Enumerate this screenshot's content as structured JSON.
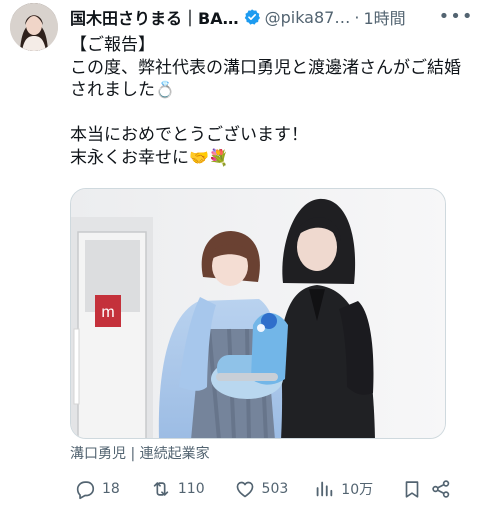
{
  "user": {
    "display_name": "国木田さりまる｜BA…",
    "handle": "@pika87…",
    "time": "1時間"
  },
  "tweet": {
    "lines": [
      "【ご報告】",
      "この度、弊社代表の溝口勇児と渡邊渚さんがご結婚",
      "されました",
      "",
      "本当におめでとうございます！",
      "末永くお幸せに"
    ],
    "emoji_ring": "💍",
    "emoji_end": "🤝💐",
    "image_caption": "溝口勇児 | 連続起業家"
  },
  "stats": {
    "replies": "18",
    "retweets": "110",
    "likes": "503",
    "views": "10万"
  },
  "colors": {
    "text": "#0f1419",
    "muted": "#536471",
    "verified": "#1d9bf0",
    "background": "#ffffff"
  },
  "icons": {
    "verified": "verified-badge-icon",
    "more": "more-dots-icon",
    "reply": "reply-icon",
    "retweet": "retweet-icon",
    "like": "heart-icon",
    "views": "views-icon",
    "bookmark": "bookmark-icon",
    "share": "share-icon"
  }
}
